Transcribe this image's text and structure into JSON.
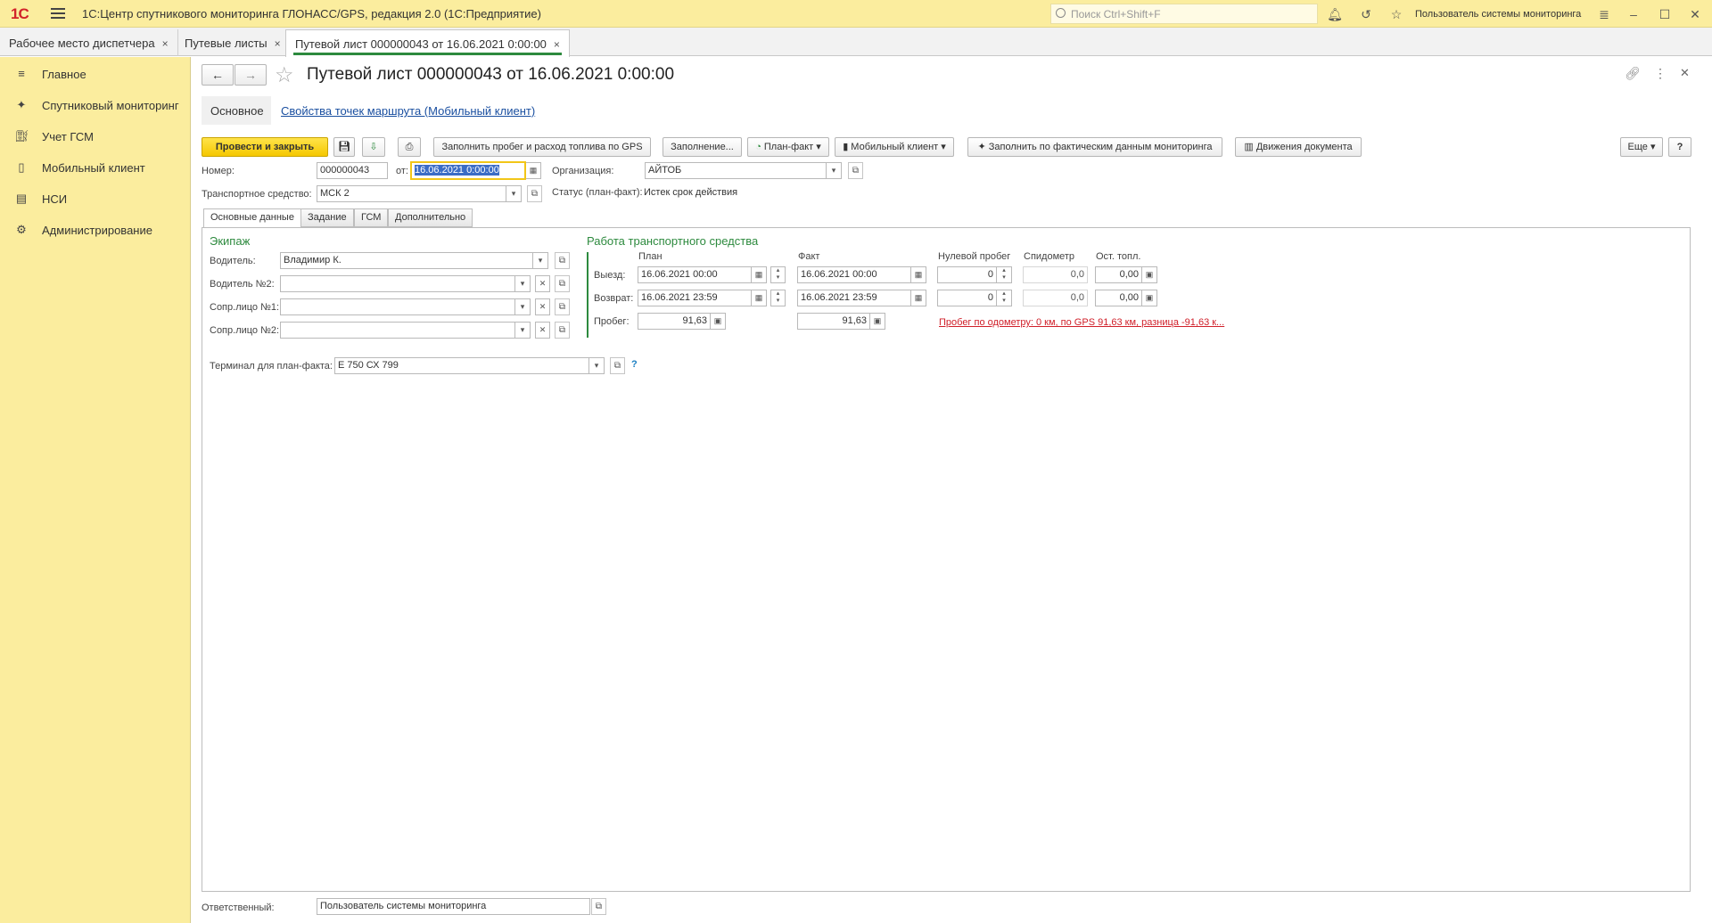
{
  "app": {
    "logo": "1С",
    "title": "1С:Центр спутникового мониторинга ГЛОНАСС/GPS, редакция 2.0  (1С:Предприятие)",
    "search_placeholder": "Поиск Ctrl+Shift+F",
    "user": "Пользователь системы мониторинга"
  },
  "tabs": [
    {
      "label": "Рабочее место диспетчера",
      "close": "×"
    },
    {
      "label": "Путевые листы",
      "close": "×"
    },
    {
      "label": "Путевой лист 000000043 от 16.06.2021 0:00:00",
      "close": "×"
    }
  ],
  "sidebar": {
    "items": [
      {
        "label": "Главное",
        "icon": "menu-icon"
      },
      {
        "label": "Спутниковый мониторинг",
        "icon": "satellite-icon"
      },
      {
        "label": "Учет ГСМ",
        "icon": "fuel-icon"
      },
      {
        "label": "Мобильный клиент",
        "icon": "mobile-icon"
      },
      {
        "label": "НСИ",
        "icon": "books-icon"
      },
      {
        "label": "Администрирование",
        "icon": "gear-icon"
      }
    ]
  },
  "form": {
    "title": "Путевой лист 000000043 от 16.06.2021 0:00:00",
    "nav_main": "Основное",
    "nav_link": "Свойства точек маршрута (Мобильный клиент)",
    "toolbar": {
      "post_close": "Провести и закрыть",
      "fill_gps": "Заполнить пробег и расход топлива по GPS",
      "fill": "Заполнение...",
      "plan_fact": "План-факт",
      "mobile_client": "Мобильный клиент",
      "fill_monitoring": "Заполнить по фактическим данным мониторинга",
      "doc_movements": "Движения документа",
      "more": "Еще",
      "help": "?"
    },
    "number_label": "Номер:",
    "number": "000000043",
    "date_label": "от:",
    "date": "16.06.2021  0:00:00",
    "org_label": "Организация:",
    "org": "АЙТОБ",
    "vehicle_label": "Транспортное средство:",
    "vehicle": "МСК 2",
    "status_label": "Статус (план-факт):",
    "status": "Истек срок действия",
    "form_tabs": [
      "Основные данные",
      "Задание",
      "ГСМ",
      "Дополнительно"
    ],
    "crew": {
      "title": "Экипаж",
      "driver_label": "Водитель:",
      "driver": "Владимир К.",
      "driver2_label": "Водитель №2:",
      "driver2": "",
      "escort1_label": "Сопр.лицо №1:",
      "escort1": "",
      "escort2_label": "Сопр.лицо №2:",
      "escort2": ""
    },
    "work": {
      "title": "Работа транспортного средства",
      "col_plan": "План",
      "col_fact": "Факт",
      "col_zero": "Нулевой пробег",
      "col_speedo": "Спидометр",
      "col_fuel": "Ост. топл.",
      "depart_label": "Выезд:",
      "return_label": "Возврат:",
      "mileage_label": "Пробег:",
      "depart_plan": "16.06.2021 00:00",
      "depart_fact": "16.06.2021 00:00",
      "depart_zero": "0",
      "depart_speedo": "0,0",
      "depart_fuel": "0,00",
      "return_plan": "16.06.2021 23:59",
      "return_fact": "16.06.2021 23:59",
      "return_zero": "0",
      "return_speedo": "0,0",
      "return_fuel": "0,00",
      "mileage_plan": "91,63",
      "mileage_fact": "91,63",
      "warning": "Пробег по одометру: 0 км, по GPS 91,63 км, разница -91,63 к..."
    },
    "terminal_label": "Терминал для план-факта:",
    "terminal": "Е 750 СХ 799",
    "terminal_help": "?",
    "responsible_label": "Ответственный:",
    "responsible": "Пользователь системы мониторинга"
  },
  "colors": {
    "accent": "#fbed9e",
    "green": "#2d8a3e",
    "link": "#1a4fa0",
    "warning": "#d0202a",
    "button_yellow": "#f5c800"
  }
}
